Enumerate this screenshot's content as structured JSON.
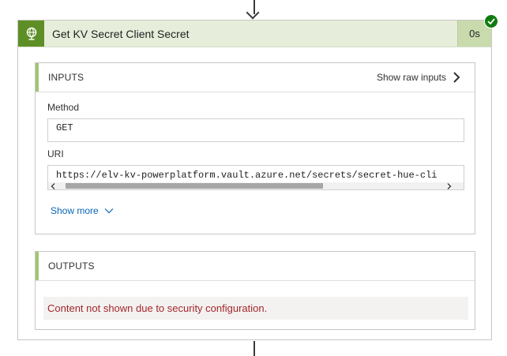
{
  "action": {
    "title": "Get KV Secret Client Secret",
    "duration": "0s",
    "status": "succeeded",
    "icon": "globe-icon"
  },
  "inputs": {
    "title": "INPUTS",
    "raw_link_label": "Show raw inputs",
    "method_label": "Method",
    "method_value": "GET",
    "uri_label": "URI",
    "uri_value": "https://elv-kv-powerplatform.vault.azure.net/secrets/secret-hue-cli",
    "show_more_label": "Show more"
  },
  "outputs": {
    "title": "OUTPUTS",
    "message": "Content not shown due to security configuration."
  },
  "colors": {
    "header_bg": "#e6eedb",
    "icon_bg": "#5e8f26",
    "success": "#107c10",
    "error_text": "#a4262c",
    "link": "#0b66b8",
    "accent_bar": "#a1c672"
  }
}
